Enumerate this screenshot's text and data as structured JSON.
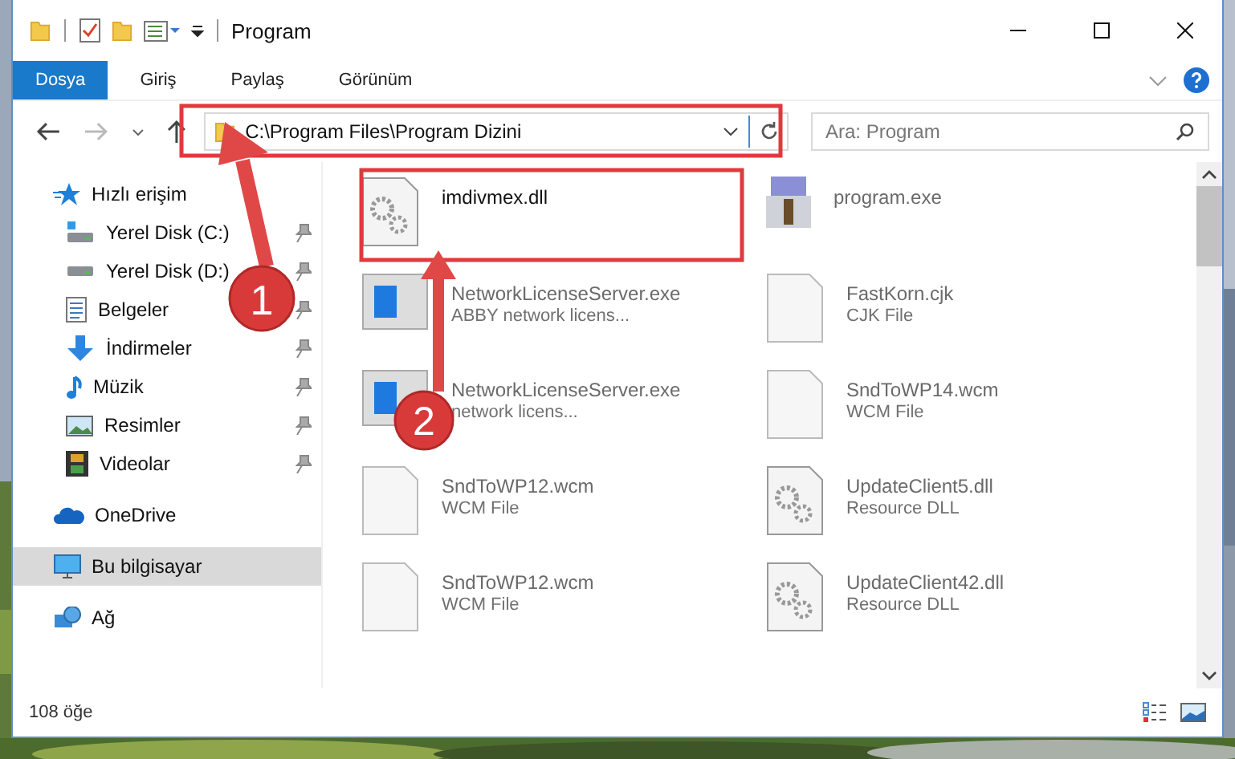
{
  "window": {
    "title": "Program"
  },
  "ribbon_tabs": [
    {
      "label": "Dosya",
      "selected": true
    },
    {
      "label": "Giriş",
      "selected": false
    },
    {
      "label": "Paylaş",
      "selected": false
    },
    {
      "label": "Görünüm",
      "selected": false
    }
  ],
  "address_bar": {
    "path": "C:\\Program Files\\Program Dizini"
  },
  "search": {
    "placeholder": "Ara: Program"
  },
  "sidebar": {
    "items": [
      {
        "label": "Hızlı erişim",
        "kind": "star",
        "selected": false,
        "children": [
          {
            "label": "Yerel Disk (C:)",
            "kind": "drive-c",
            "pinned": true,
            "selected": false
          },
          {
            "label": "Yerel Disk (D:)",
            "kind": "drive",
            "pinned": true,
            "selected": false
          },
          {
            "label": "Belgeler",
            "kind": "docs",
            "pinned": true,
            "selected": false
          },
          {
            "label": "İndirmeler",
            "kind": "download",
            "pinned": true,
            "selected": false
          },
          {
            "label": "Müzik",
            "kind": "music",
            "pinned": true,
            "selected": false
          },
          {
            "label": "Resimler",
            "kind": "pictures",
            "pinned": true,
            "selected": false
          },
          {
            "label": "Videolar",
            "kind": "videos",
            "pinned": true,
            "selected": false
          }
        ]
      },
      {
        "label": "OneDrive",
        "kind": "cloud",
        "selected": false
      },
      {
        "label": "Bu bilgisayar",
        "kind": "pc",
        "selected": true
      },
      {
        "label": "Ağ",
        "kind": "network",
        "selected": false
      }
    ]
  },
  "files": [
    {
      "name": "imdivmex.dll",
      "kind": "dll",
      "dimmed": false
    },
    {
      "name": "program.exe",
      "kind": "app",
      "dimmed": true
    },
    {
      "name": "NetworkLicenseServer.exe",
      "type": "ABBY network licens...",
      "kind": "server",
      "dimmed": true
    },
    {
      "name": "FastKorn.cjk",
      "type": "CJK File",
      "kind": "blank",
      "dimmed": true
    },
    {
      "name": "NetworkLicenseServer.exe",
      "type": "network licens...",
      "kind": "server",
      "dimmed": true
    },
    {
      "name": "SndToWP14.wcm",
      "type": "WCM File",
      "kind": "blank",
      "dimmed": true
    },
    {
      "name": "SndToWP12.wcm",
      "type": "WCM File",
      "kind": "blank",
      "dimmed": true
    },
    {
      "name": "UpdateClient5.dll",
      "type": "Resource DLL",
      "kind": "dll",
      "dimmed": true
    },
    {
      "name": "SndToWP12.wcm",
      "type": "WCM File",
      "kind": "blank",
      "dimmed": true
    },
    {
      "name": "UpdateClient42.dll",
      "type": "Resource DLL",
      "kind": "dll",
      "dimmed": true
    }
  ],
  "status_bar": {
    "item_count": "108 öğe"
  },
  "annotations": [
    {
      "label": "1"
    },
    {
      "label": "2"
    }
  ]
}
